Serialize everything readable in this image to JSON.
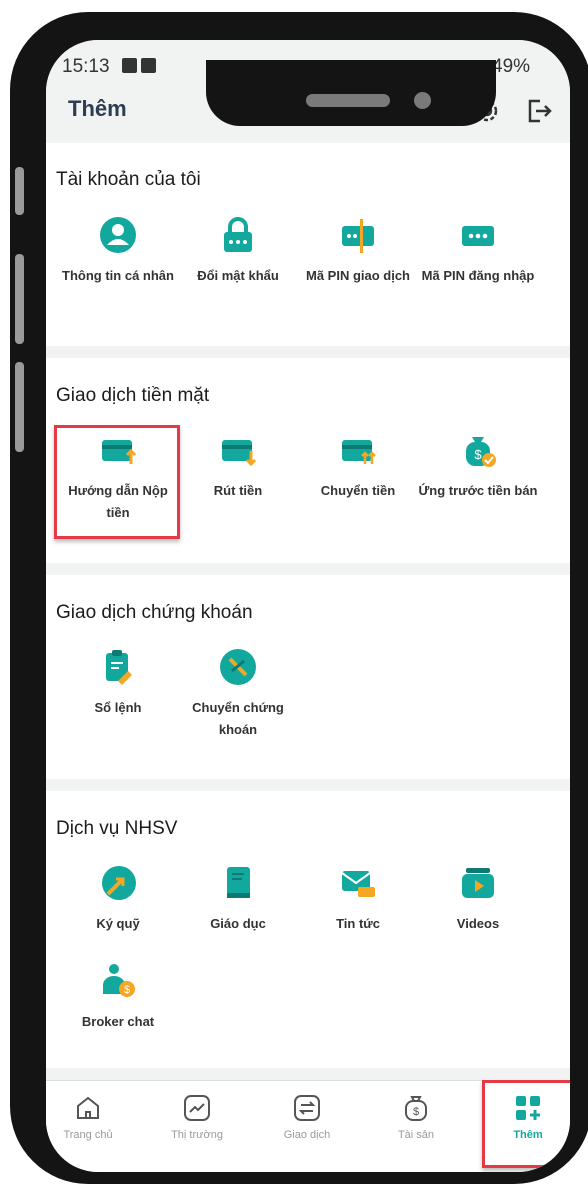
{
  "status_bar": {
    "time": "15:13",
    "battery": "49%"
  },
  "header": {
    "title": "Thêm",
    "icons": [
      "headset-icon",
      "gear-icon",
      "logout-icon"
    ]
  },
  "sections": [
    {
      "title": "Tài khoản của tôi",
      "items": [
        {
          "label": "Thông tin cá nhân",
          "icon": "user-icon"
        },
        {
          "label": "Đổi mật khẩu",
          "icon": "lock-icon"
        },
        {
          "label": "Mã PIN giao dịch",
          "icon": "pin-transaction-icon"
        },
        {
          "label": "Mã PIN đăng nhập",
          "icon": "pin-login-icon"
        }
      ]
    },
    {
      "title": "Giao dịch tiền mặt",
      "items": [
        {
          "label": "Hướng dẫn Nộp tiền",
          "icon": "deposit-card-icon"
        },
        {
          "label": "Rút tiền",
          "icon": "withdraw-card-icon"
        },
        {
          "label": "Chuyển tiền",
          "icon": "transfer-card-icon"
        },
        {
          "label": "Ứng trước tiền bán",
          "icon": "advance-bag-icon"
        }
      ]
    },
    {
      "title": "Giao dịch chứng khoán",
      "items": [
        {
          "label": "Sổ lệnh",
          "icon": "order-book-icon"
        },
        {
          "label": "Chuyển chứng khoán",
          "icon": "stock-transfer-icon"
        }
      ]
    },
    {
      "title": "Dịch vụ NHSV",
      "items": [
        {
          "label": "Ký quỹ",
          "icon": "margin-icon"
        },
        {
          "label": "Giáo dục",
          "icon": "book-icon"
        },
        {
          "label": "Tin tức",
          "icon": "news-icon"
        },
        {
          "label": "Videos",
          "icon": "video-icon"
        },
        {
          "label": "Broker chat",
          "icon": "broker-chat-icon"
        }
      ]
    }
  ],
  "nav": [
    {
      "label": "Trang chủ",
      "icon": "home-icon"
    },
    {
      "label": "Thị trường",
      "icon": "market-icon"
    },
    {
      "label": "Giao dịch",
      "icon": "trade-icon"
    },
    {
      "label": "Tài sản",
      "icon": "assets-icon"
    },
    {
      "label": "Thêm",
      "icon": "more-grid-icon",
      "active": true
    }
  ],
  "colors": {
    "accent": "#13a89e",
    "orange": "#f5a623",
    "highlight": "#e63946",
    "title_text": "#2c3e50"
  }
}
